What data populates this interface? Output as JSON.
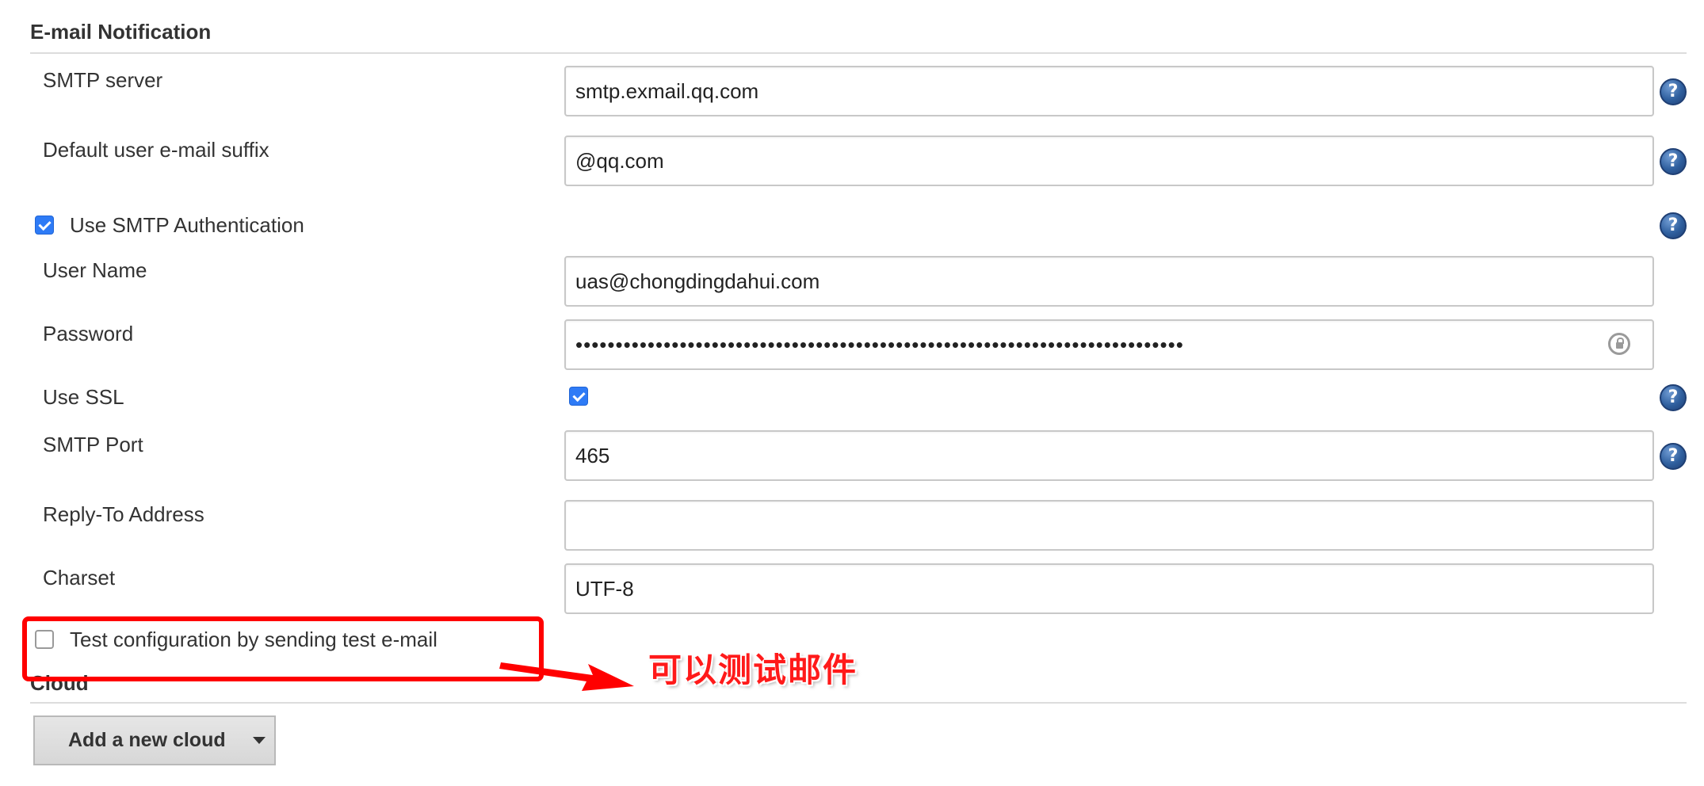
{
  "email_section": {
    "title": "E-mail Notification",
    "smtp_server": {
      "label": "SMTP server",
      "value": "smtp.exmail.qq.com"
    },
    "default_suffix": {
      "label": "Default user e-mail suffix",
      "value": "@qq.com"
    },
    "use_smtp_auth": {
      "label": "Use SMTP Authentication",
      "checked": true
    },
    "user_name": {
      "label": "User Name",
      "value": "uas@chongdingdahui.com"
    },
    "password": {
      "label": "Password",
      "value": "••••••••••••••••••••••••••••••••••••••••••••••••••••••••••••••••••••••••••••"
    },
    "use_ssl": {
      "label": "Use SSL",
      "checked": true
    },
    "smtp_port": {
      "label": "SMTP Port",
      "value": "465"
    },
    "reply_to": {
      "label": "Reply-To Address",
      "value": ""
    },
    "charset": {
      "label": "Charset",
      "value": "UTF-8"
    },
    "test_config": {
      "label": "Test configuration by sending test e-mail",
      "checked": false
    }
  },
  "cloud_section": {
    "title": "Cloud",
    "add_button_label": "Add a new cloud"
  },
  "annotation": {
    "text": "可以测试邮件",
    "color": "#ff0000"
  },
  "icons": {
    "help": "help-icon",
    "password_lock": "lock-refresh-icon",
    "dropdown": "caret-down-icon"
  },
  "colors": {
    "checkbox_accent": "#2e7bf6",
    "help_icon": "#2f5f9e"
  }
}
